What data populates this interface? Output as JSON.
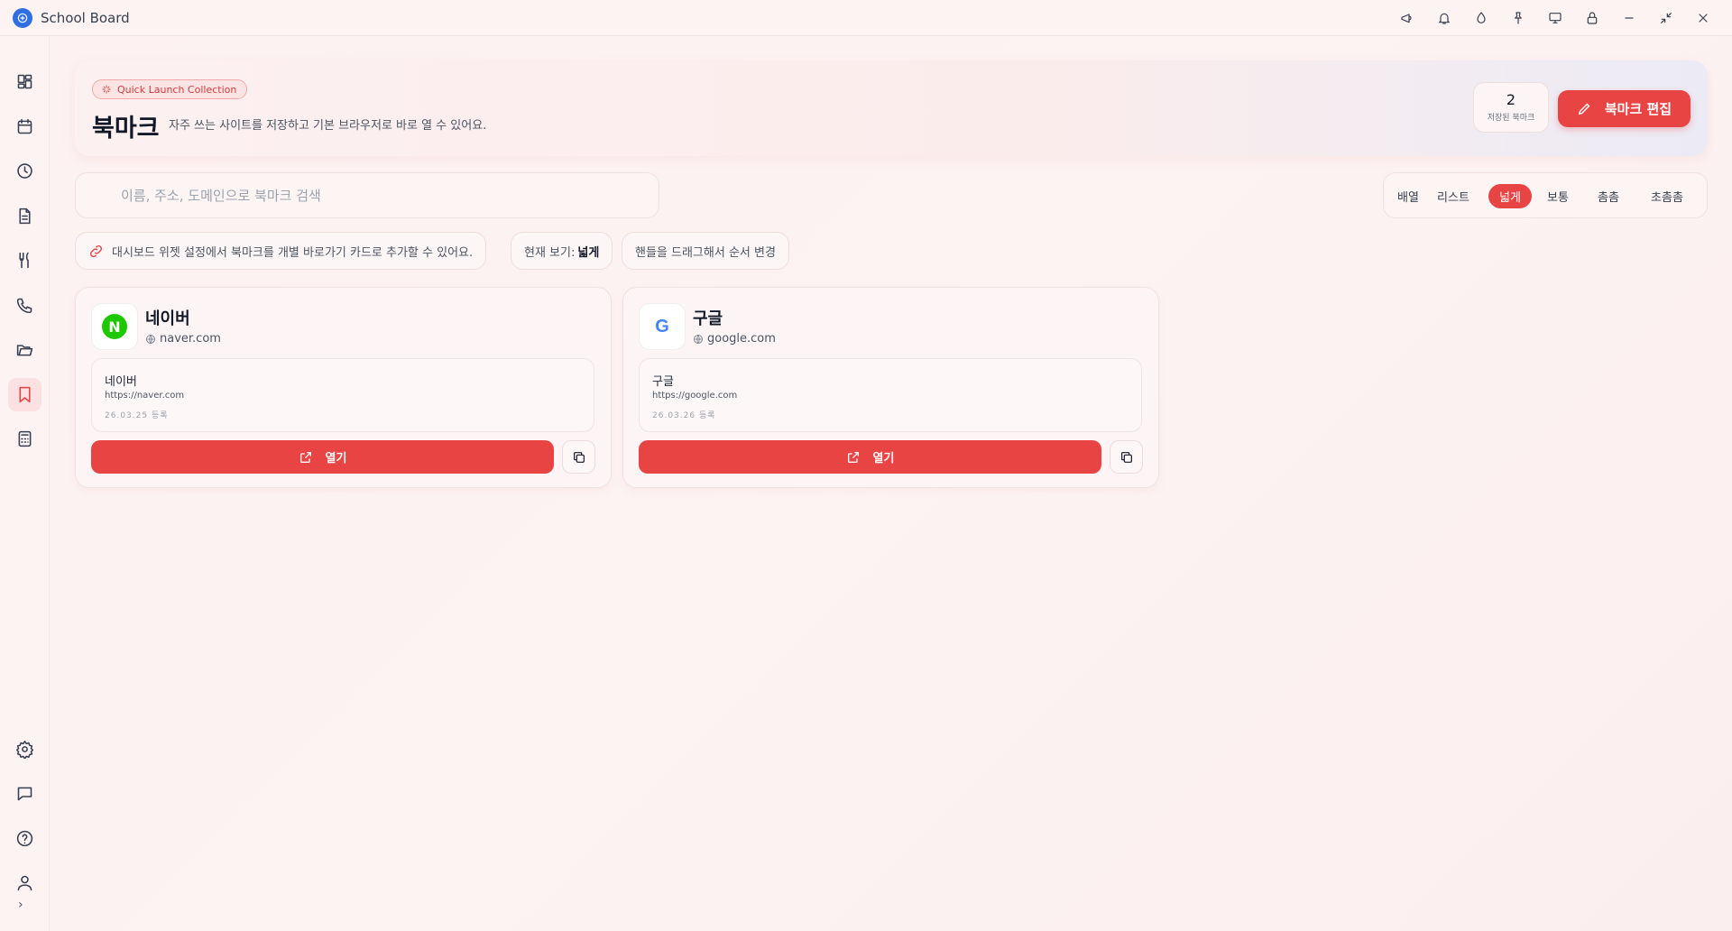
{
  "app": {
    "title": "School Board"
  },
  "titlebar": {
    "icons": [
      "megaphone-icon",
      "bell-icon",
      "droplet-icon",
      "pin-icon",
      "monitor-icon",
      "lock-icon",
      "minimize-icon",
      "collapse-icon",
      "close-icon"
    ]
  },
  "sidebar": {
    "items": [
      "dashboard",
      "calendar",
      "clock",
      "document",
      "meal",
      "phone",
      "folder",
      "bookmark",
      "calculator"
    ],
    "bottom_items": [
      "settings",
      "chat",
      "help",
      "user"
    ],
    "expand_label": "›",
    "active": "bookmark"
  },
  "hero": {
    "tag": "Quick Launch Collection",
    "title": "북마크",
    "description": "자주 쓰는 사이트를 저장하고 기본 브라우저로 바로 열 수 있어요.",
    "count": "2",
    "count_label": "저장된 북마크",
    "edit_label": "북마크 편집"
  },
  "search": {
    "placeholder": "이름, 주소, 도메인으로 북마크 검색",
    "value": ""
  },
  "view_switch": {
    "options": [
      "배열",
      "리스트",
      "넓게",
      "보통",
      "촘촘",
      "초촘촘"
    ],
    "selected": "넓게"
  },
  "chips": {
    "hint": "대시보드 위젯 설정에서 북마크를 개별 바로가기 카드로 추가할 수 있어요.",
    "current_view_label": "현재 보기:",
    "current_view_value": "넓게",
    "drag_hint": "핸들을 드래그해서 순서 변경"
  },
  "bookmarks": [
    {
      "name": "네이버",
      "domain": "naver.com",
      "detail_title": "네이버",
      "url": "https://naver.com",
      "date": "26.03.25 등록",
      "open_label": "열기",
      "logo_text": "N"
    },
    {
      "name": "구글",
      "domain": "google.com",
      "detail_title": "구글",
      "url": "https://google.com",
      "date": "26.03.26 등록",
      "open_label": "열기",
      "logo_text": "G"
    }
  ],
  "colors": {
    "accent": "#e94444",
    "active_bg": "#fbe1e1",
    "background": "#fdf2f2"
  }
}
